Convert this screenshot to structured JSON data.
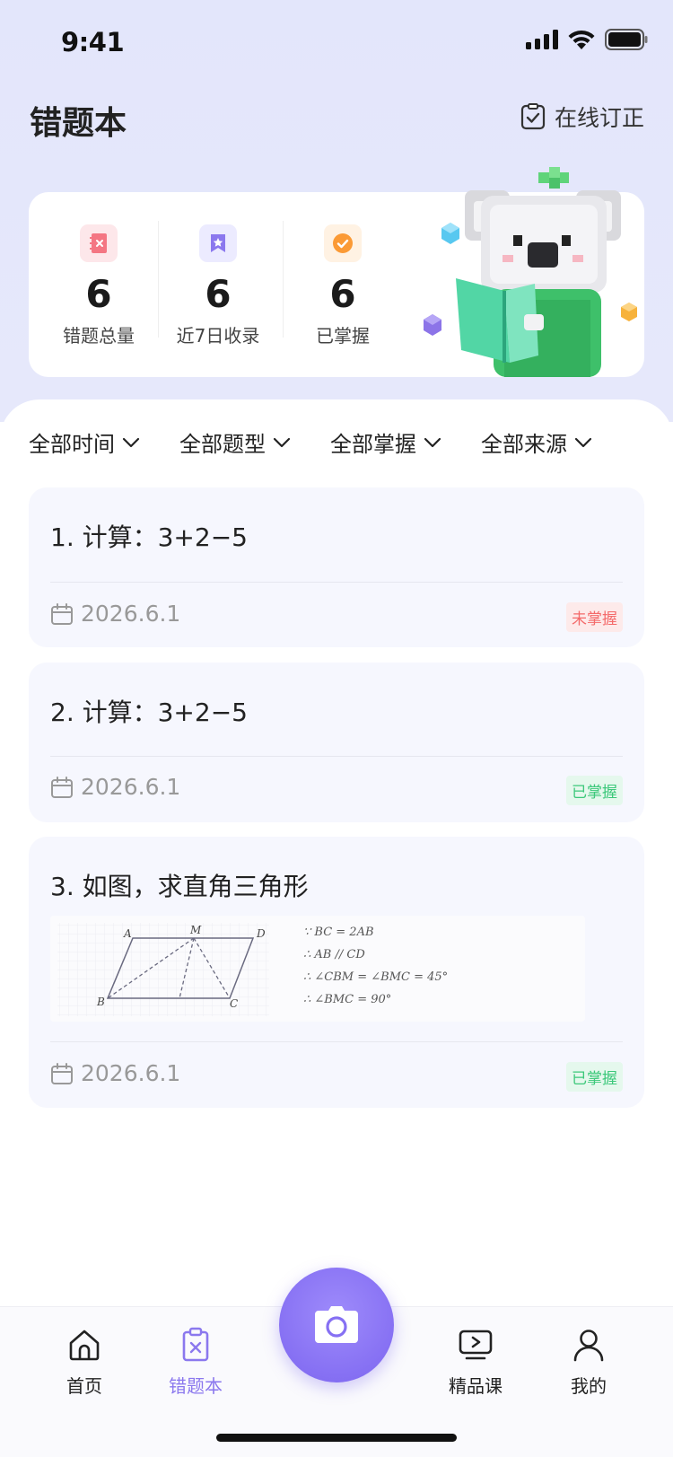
{
  "status": {
    "time": "9:41"
  },
  "header": {
    "title": "错题本",
    "online_fix_label": "在线订正"
  },
  "stats": [
    {
      "value": "6",
      "label": "错题总量",
      "icon": "notebook-x-icon",
      "icon_bg": "#fde7ea",
      "icon_color": "#f47683"
    },
    {
      "value": "6",
      "label": "近7日收录",
      "icon": "bookmark-star-icon",
      "icon_bg": "#ecebff",
      "icon_color": "#8b78ee"
    },
    {
      "value": "6",
      "label": "已掌握",
      "icon": "check-circle-icon",
      "icon_bg": "#fff2e3",
      "icon_color": "#fb9a35"
    }
  ],
  "filters": [
    {
      "label": "全部时间"
    },
    {
      "label": "全部题型"
    },
    {
      "label": "全部掌握"
    },
    {
      "label": "全部来源"
    }
  ],
  "questions": [
    {
      "title": "1. 计算：3+2−5",
      "date": "2026.6.1",
      "status": "未掌握",
      "status_color": "red"
    },
    {
      "title": "2. 计算：3+2−5",
      "date": "2026.6.1",
      "status": "已掌握",
      "status_color": "green"
    },
    {
      "title": "3. 如图，求直角三角形",
      "date": "2026.6.1",
      "status": "已掌握",
      "status_color": "green",
      "figure": {
        "points": [
          "A",
          "M",
          "D",
          "B",
          "C"
        ],
        "steps": [
          "∵  BC = 2AB",
          "∴  AB // CD",
          "∴  ∠CBM = ∠BMC = 45°",
          "∴  ∠BMC = 90°"
        ]
      }
    }
  ],
  "tabbar": {
    "items": [
      {
        "label": "首页",
        "icon": "home-icon"
      },
      {
        "label": "错题本",
        "icon": "clipboard-x-icon",
        "active": true
      },
      {
        "label": "精品课",
        "icon": "play-course-icon"
      },
      {
        "label": "我的",
        "icon": "user-icon"
      }
    ],
    "camera_icon": "camera-icon"
  },
  "colors": {
    "accent": "#8b78ee",
    "background_top": "#e3e6fb"
  }
}
